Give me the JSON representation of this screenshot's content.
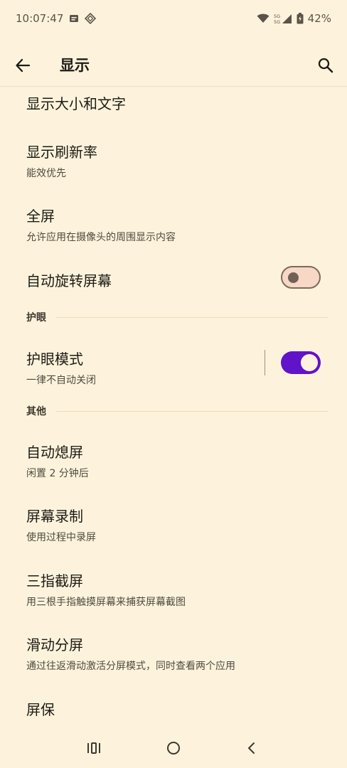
{
  "status_bar": {
    "time": "10:07:47",
    "network_label": "5G",
    "battery": "42%"
  },
  "header": {
    "title": "显示",
    "back_icon": "arrow-left-icon",
    "search_icon": "search-icon"
  },
  "items": {
    "display_size": {
      "title": "显示大小和文字"
    },
    "refresh_rate": {
      "title": "显示刷新率",
      "subtitle": "能效优先"
    },
    "fullscreen": {
      "title": "全屏",
      "subtitle": "允许应用在摄像头的周围显示内容"
    },
    "auto_rotate": {
      "title": "自动旋转屏幕",
      "enabled": false
    },
    "eye_mode": {
      "title": "护眼模式",
      "subtitle": "一律不自动关闭",
      "enabled": true
    },
    "screen_off": {
      "title": "自动熄屏",
      "subtitle": "闲置 2 分钟后"
    },
    "screen_record": {
      "title": "屏幕录制",
      "subtitle": "使用过程中录屏"
    },
    "three_finger": {
      "title": "三指截屏",
      "subtitle": "用三根手指触摸屏幕来捕获屏幕截图"
    },
    "split_screen": {
      "title": "滑动分屏",
      "subtitle": "通过往返滑动激活分屏模式，同时查看两个应用"
    },
    "screensaver": {
      "title": "屏保"
    }
  },
  "sections": {
    "eye_care": "护眼",
    "other": "其他"
  },
  "colors": {
    "background": "#fdf3dc",
    "accent": "#6113c9"
  }
}
